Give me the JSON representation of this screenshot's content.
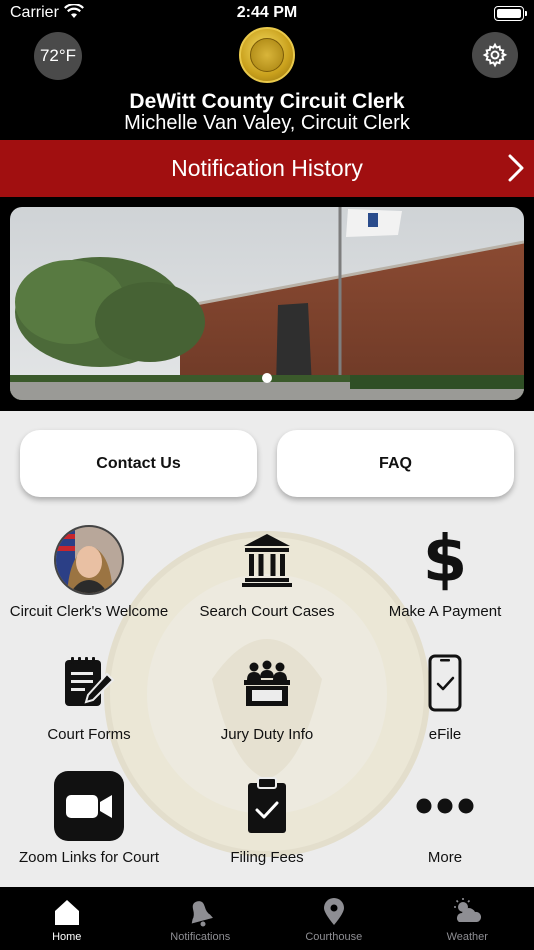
{
  "status_bar": {
    "carrier": "Carrier",
    "time": "2:44 PM"
  },
  "header": {
    "temperature": "72°F",
    "title": "DeWitt County Circuit Clerk",
    "subtitle": "Michelle Van Valey, Circuit Clerk"
  },
  "notification_bar": {
    "label": "Notification History"
  },
  "carousel": {
    "page_count": 1,
    "current_page": 1
  },
  "buttons": {
    "contact": "Contact Us",
    "faq": "FAQ"
  },
  "tiles": [
    {
      "label": "Circuit Clerk's Welcome",
      "icon": "clerk-avatar"
    },
    {
      "label": "Search Court Cases",
      "icon": "courthouse-icon"
    },
    {
      "label": "Make A Payment",
      "icon": "dollar-icon"
    },
    {
      "label": "Court Forms",
      "icon": "form-edit-icon"
    },
    {
      "label": "Jury Duty Info",
      "icon": "jury-box-icon"
    },
    {
      "label": "eFile",
      "icon": "phone-check-icon"
    },
    {
      "label": "Zoom Links for Court",
      "icon": "video-camera-icon"
    },
    {
      "label": "Filing Fees",
      "icon": "clipboard-check-icon"
    },
    {
      "label": "More",
      "icon": "more-dots-icon"
    }
  ],
  "tabbar": {
    "items": [
      {
        "label": "Home",
        "icon": "home-icon",
        "active": true
      },
      {
        "label": "Notifications",
        "icon": "bell-icon",
        "active": false
      },
      {
        "label": "Courthouse",
        "icon": "location-pin-icon",
        "active": false
      },
      {
        "label": "Weather",
        "icon": "weather-icon",
        "active": false
      }
    ]
  },
  "colors": {
    "accent_red": "#a10f10",
    "background": "#ececec",
    "header": "#000000"
  }
}
